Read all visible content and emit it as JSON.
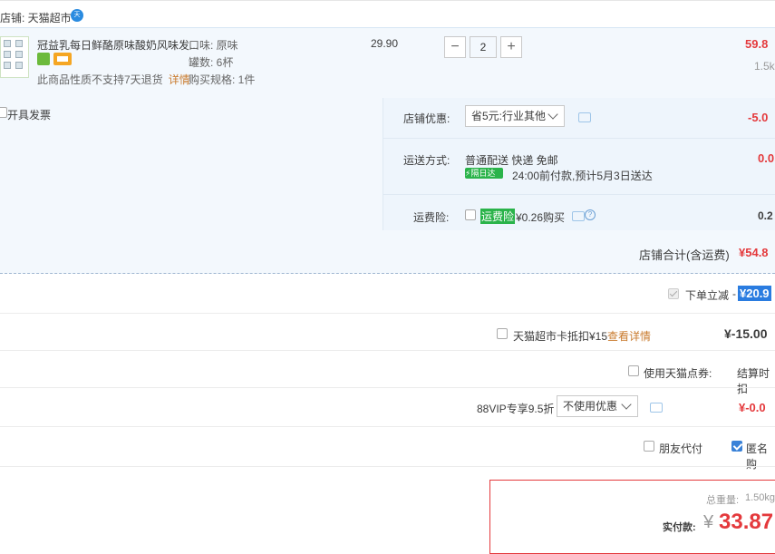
{
  "shop": {
    "label": "店铺: 天猫超市",
    "badge": "天"
  },
  "item": {
    "title": "冠益乳每日鲜酪原味酸奶风味发...",
    "note": "此商品性质不支持7天退货",
    "detail_link": "详情",
    "attrs": [
      "口味: 原味",
      "罐数: 6杯",
      "购买规格: 1件"
    ],
    "price": "29.90",
    "qty": "2",
    "minus": "−",
    "plus": "+",
    "subtotal": "59.8",
    "weight": "1.5k"
  },
  "invoice": {
    "label": "开具发票"
  },
  "discount": {
    "label": "店铺优惠:",
    "select": "省5元:行业其他",
    "amount": "-5.0"
  },
  "shipping": {
    "label": "运送方式:",
    "method": "普通配送 快递 免邮",
    "tag": "隔日达",
    "eta": "24:00前付款,预计5月3日送达",
    "amount": "0.0"
  },
  "insurance": {
    "label": "运费险:",
    "tag": "运费险",
    "price": "¥0.26购买",
    "amount": "0.2"
  },
  "shop_total": {
    "label": "店铺合计(含运费)",
    "amount": "¥54.8"
  },
  "instant_discount": {
    "label": "下单立减",
    "dash": "-",
    "amount": "¥20.9"
  },
  "card": {
    "label": "天猫超市卡抵扣¥15",
    "link": "查看详情",
    "amount": "¥-15.00"
  },
  "points": {
    "label": "使用天猫点券:",
    "value": "结算时扣"
  },
  "vip": {
    "label": "88VIP专享9.5折",
    "select": "不使用优惠",
    "amount": "¥-0.0"
  },
  "friend_pay": {
    "label": "朋友代付"
  },
  "anon_buy": {
    "label": "匿名购"
  },
  "pay": {
    "weight_label": "总重量: ",
    "weight_value": "1.50kg",
    "actual_label": "实付款: ",
    "currency": "¥",
    "amount": "33.87"
  },
  "colors": {
    "accent_red": "#e4393c",
    "highlight_blue": "#2a7ce0",
    "band": "#f3f8fd"
  }
}
